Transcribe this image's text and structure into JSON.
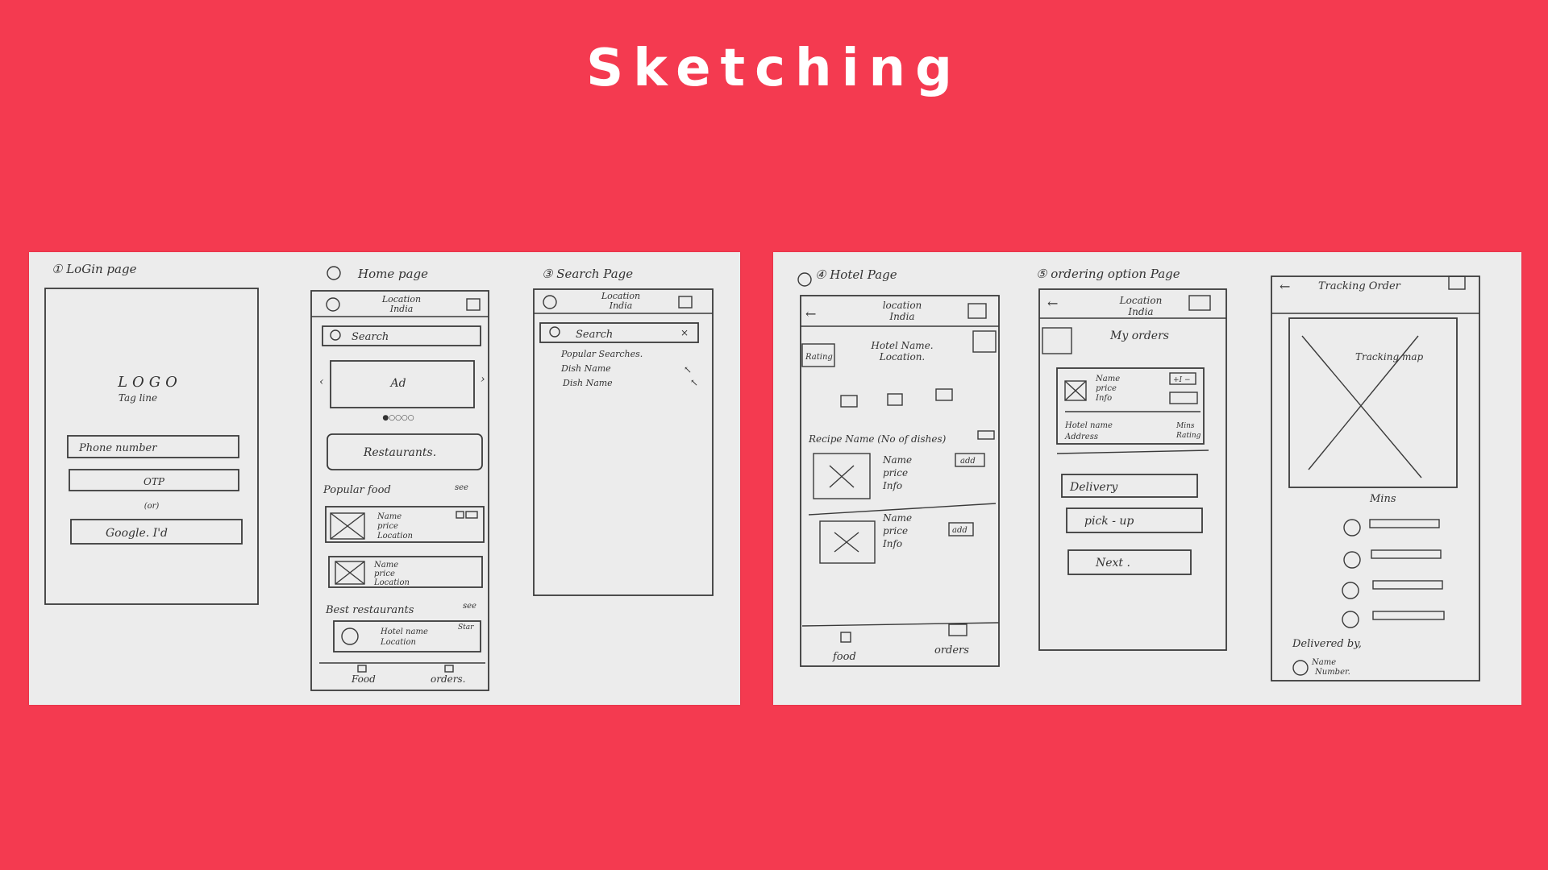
{
  "page": {
    "title": "Sketching"
  },
  "sketch_left": {
    "login": {
      "heading": "① LoGin page",
      "logo": "LOGO",
      "tagline": "Tag line",
      "phone": "Phone number",
      "otp": "OTP",
      "or": "(or)",
      "google": "Google. I'd"
    },
    "home": {
      "heading": "Home page",
      "location": "Location",
      "country": "India",
      "search": "Search",
      "ad": "Ad",
      "restaurants": "Restaurants.",
      "popular_food": "Popular food",
      "see": "see",
      "item_name": "Name",
      "item_price": "price",
      "item_location": "Location",
      "best_restaurants": "Best restaurants",
      "hotel_name": "Hotel name",
      "hotel_location": "Location",
      "star": "Star",
      "nav_food": "Food",
      "nav_orders": "orders."
    },
    "search": {
      "heading": "③ Search Page",
      "location": "Location",
      "country": "India",
      "search": "Search",
      "popular": "Popular Searches.",
      "dish1": "Dish Name",
      "dish2": "Dish Name"
    }
  },
  "sketch_right": {
    "hotel": {
      "heading": "④ Hotel Page",
      "location": "location",
      "country": "India",
      "rating": "Rating",
      "hotel_name": "Hotel Name.",
      "hotel_location": "Location.",
      "recipe": "Recipe Name (No of dishes)",
      "name": "Name",
      "price": "price",
      "info": "Info",
      "add": "add",
      "nav_food": "food",
      "nav_orders": "orders"
    },
    "ordering": {
      "heading": "⑤ ordering option Page",
      "location": "Location",
      "country": "India",
      "my_orders": "My orders",
      "name": "Name",
      "price": "price",
      "info": "Info",
      "hotel_name": "Hotel name",
      "address": "Address",
      "mins": "Mins",
      "rating": "Rating",
      "delivery": "Delivery",
      "pickup": "pick - up",
      "next": "Next ."
    },
    "tracking": {
      "heading": "Tracking Order",
      "map": "Tracking map",
      "mins": "Mins",
      "delivered_by": "Delivered by,",
      "name": "Name",
      "number": "Number."
    }
  }
}
